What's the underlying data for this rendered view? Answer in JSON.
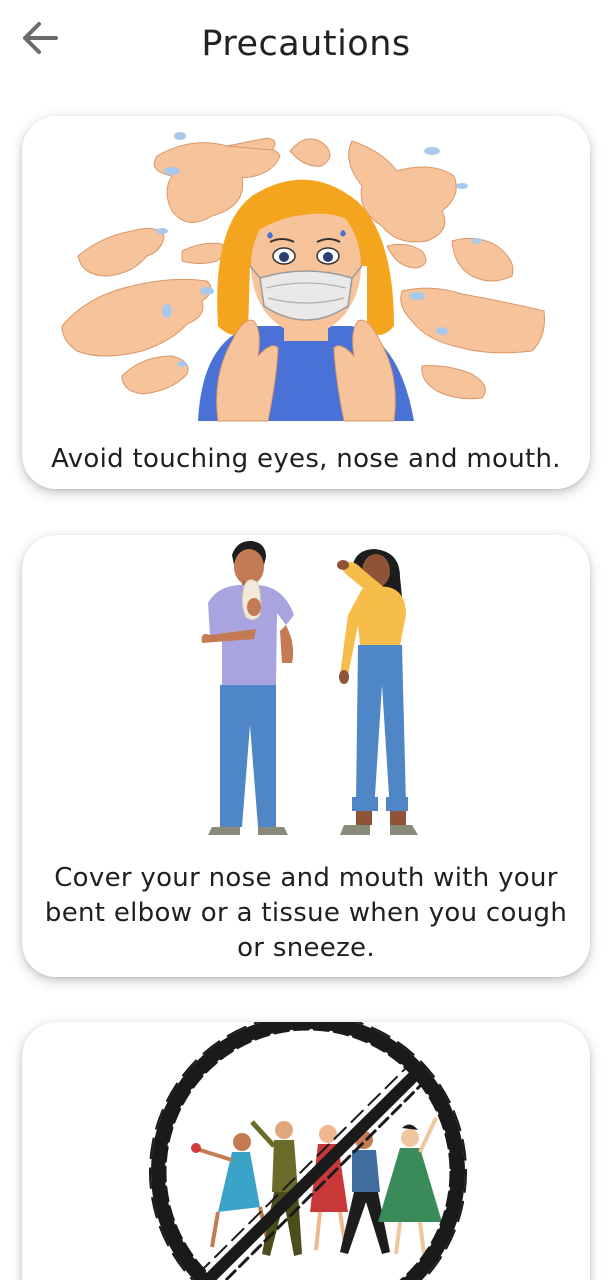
{
  "header": {
    "title": "Precautions",
    "back_icon": "arrow-left-icon"
  },
  "cards": [
    {
      "caption": "Avoid touching eyes, nose and mouth.",
      "illustration": "woman-masked-surrounded-by-hands"
    },
    {
      "caption": "Cover your nose and mouth with your bent elbow or a tissue when you cough or sneeze.",
      "illustration": "man-with-tissue-woman-coughing-into-elbow"
    },
    {
      "caption": "",
      "illustration": "crowd-dancing-prohibited-sign"
    }
  ],
  "colors": {
    "background": "#ffffff",
    "title": "#222222",
    "icon": "#6b6b6b",
    "skin": "#f6c39a",
    "hair": "#f5a51d",
    "shirt_blue": "#4a72d6",
    "jeans": "#4f86c6"
  }
}
